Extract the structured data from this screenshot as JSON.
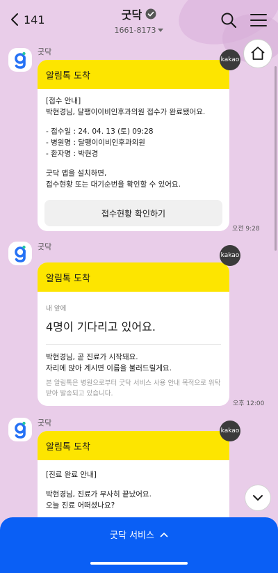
{
  "header": {
    "back_count": "141",
    "title": "굿닥",
    "phone": "1661-8173"
  },
  "messages": [
    {
      "sender": "굿닥",
      "card_title": "알림톡 도착",
      "kakao_label": "kakao",
      "lines": [
        "[접수 안내]",
        "박현경님, 달팽이이비인후과의원 접수가 완료됐어요."
      ],
      "details": [
        "- 접수일 : 24. 04. 13 (토) 09:28",
        "- 병원명 : 달팽이이비인후과의원",
        "- 환자명 : 박현경"
      ],
      "footer_lines": [
        "굿닥 앱을 설치하면,",
        "접수현황 또는 대기순번을 확인할 수 있어요."
      ],
      "button_label": "접수현황 확인하기",
      "time": "오전 9:28"
    },
    {
      "sender": "굿닥",
      "card_title": "알림톡 도착",
      "kakao_label": "kakao",
      "small_label": "내 앞에",
      "big_text": "4명이 기다리고 있어요.",
      "lines": [
        "박현경님, 곧 진료가 시작돼요.",
        "자리에 앉아 계시면 이름을 불러드릴게요."
      ],
      "note": "본 알림톡은 병원으로부터 굿닥 서비스 사용 안내 목적으로 위탁받아 발송되고 있습니다.",
      "time": "오후 12:00"
    },
    {
      "sender": "굿닥",
      "card_title": "알림톡 도착",
      "kakao_label": "kakao",
      "lines": [
        "[진료 완료 안내]",
        "박현경님, 진료가 무사히 끝났어요.",
        "오늘 진료 어떠셨나요?"
      ]
    }
  ],
  "bottom": {
    "label": "굿닥 서비스"
  },
  "colors": {
    "background": "#e9cde9",
    "card_header": "#fde500",
    "bottom_bar": "#0a5ff5"
  }
}
